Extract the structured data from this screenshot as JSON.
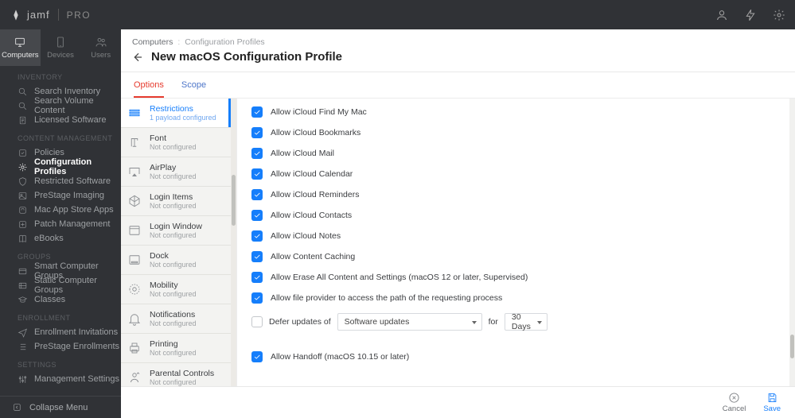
{
  "brand": {
    "name": "jamf",
    "product": "PRO"
  },
  "context_tabs": [
    {
      "label": "Computers",
      "active": true
    },
    {
      "label": "Devices",
      "active": false
    },
    {
      "label": "Users",
      "active": false
    }
  ],
  "sidebar": {
    "sections": [
      {
        "heading": "INVENTORY",
        "items": [
          {
            "icon": "search",
            "label": "Search Inventory"
          },
          {
            "icon": "search",
            "label": "Search Volume Content"
          },
          {
            "icon": "doc",
            "label": "Licensed Software"
          }
        ]
      },
      {
        "heading": "CONTENT MANAGEMENT",
        "items": [
          {
            "icon": "policy",
            "label": "Policies"
          },
          {
            "icon": "gear",
            "label": "Configuration Profiles",
            "active": true
          },
          {
            "icon": "shield",
            "label": "Restricted Software"
          },
          {
            "icon": "image",
            "label": "PreStage Imaging"
          },
          {
            "icon": "app",
            "label": "Mac App Store Apps"
          },
          {
            "icon": "patch",
            "label": "Patch Management"
          },
          {
            "icon": "book",
            "label": "eBooks"
          }
        ]
      },
      {
        "heading": "GROUPS",
        "items": [
          {
            "icon": "smart",
            "label": "Smart Computer Groups"
          },
          {
            "icon": "static",
            "label": "Static Computer Groups"
          },
          {
            "icon": "class",
            "label": "Classes"
          }
        ]
      },
      {
        "heading": "ENROLLMENT",
        "items": [
          {
            "icon": "send",
            "label": "Enrollment Invitations"
          },
          {
            "icon": "list",
            "label": "PreStage Enrollments"
          }
        ]
      },
      {
        "heading": "SETTINGS",
        "items": [
          {
            "icon": "sliders",
            "label": "Management Settings"
          }
        ]
      }
    ],
    "collapse": "Collapse Menu"
  },
  "breadcrumb": {
    "root": "Computers",
    "current": "Configuration Profiles"
  },
  "page_title": "New macOS Configuration Profile",
  "tabs": [
    {
      "label": "Options",
      "active": true
    },
    {
      "label": "Scope",
      "active": false
    }
  ],
  "payloads": [
    {
      "icon": "restrictions",
      "name": "Restrictions",
      "sub": "1 payload configured",
      "active": true
    },
    {
      "icon": "font",
      "name": "Font",
      "sub": "Not configured"
    },
    {
      "icon": "airplay",
      "name": "AirPlay",
      "sub": "Not configured"
    },
    {
      "icon": "login",
      "name": "Login Items",
      "sub": "Not configured"
    },
    {
      "icon": "window",
      "name": "Login Window",
      "sub": "Not configured"
    },
    {
      "icon": "dock",
      "name": "Dock",
      "sub": "Not configured"
    },
    {
      "icon": "mobility",
      "name": "Mobility",
      "sub": "Not configured"
    },
    {
      "icon": "bell",
      "name": "Notifications",
      "sub": "Not configured"
    },
    {
      "icon": "printer",
      "name": "Printing",
      "sub": "Not configured"
    },
    {
      "icon": "parental",
      "name": "Parental Controls",
      "sub": "Not configured"
    }
  ],
  "settings": {
    "checks": [
      {
        "label": "Allow iCloud Find My Mac",
        "checked": true
      },
      {
        "label": "Allow iCloud Bookmarks",
        "checked": true
      },
      {
        "label": "Allow iCloud Mail",
        "checked": true
      },
      {
        "label": "Allow iCloud Calendar",
        "checked": true
      },
      {
        "label": "Allow iCloud Reminders",
        "checked": true
      },
      {
        "label": "Allow iCloud Contacts",
        "checked": true
      },
      {
        "label": "Allow iCloud Notes",
        "checked": true
      },
      {
        "label": "Allow Content Caching",
        "checked": true
      },
      {
        "label": "Allow Erase All Content and Settings (macOS 12 or later, Supervised)",
        "checked": true
      },
      {
        "label": "Allow file provider to access the path of the requesting process",
        "checked": true
      }
    ],
    "defer": {
      "checked": false,
      "prefix": "Defer updates of",
      "type_value": "Software updates",
      "mid": "for",
      "days_value": "30 Days"
    },
    "handoff": {
      "label": "Allow Handoff (macOS 10.15 or later)",
      "checked": true
    }
  },
  "footer": {
    "cancel": "Cancel",
    "save": "Save"
  }
}
